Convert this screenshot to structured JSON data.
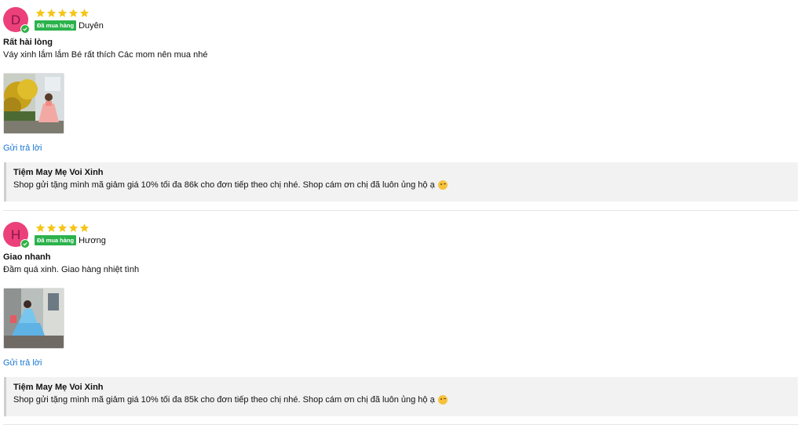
{
  "reviews": [
    {
      "avatar_letter": "D",
      "avatar_color": "#ec407a",
      "rating": 5,
      "badge": "Đã mua hàng",
      "author": "Duyên",
      "title": "Rất hài lòng",
      "text": "Váy xinh lắm lắm Bé rất thích Các mom nên mua nhé",
      "photo": "photo-girl-pink-dress-yellow-flowers",
      "reply_label": "Gửi trả lời",
      "shop_reply": {
        "shop_name": "Tiệm May Mẹ Voi Xinh",
        "text": "Shop gửi tặng mình mã giảm giá 10% tối đa 86k cho đơn tiếp theo chị nhé. Shop cám ơn chị đã luôn ủng hộ ạ",
        "emoji": "face-blowing-kiss-icon"
      }
    },
    {
      "avatar_letter": "H",
      "avatar_color": "#ec407a",
      "rating": 5,
      "badge": "Đã mua hàng",
      "author": "Hương",
      "title": "Giao nhanh",
      "text": "Đầm quá xinh. Giao hàng nhiệt tình",
      "photo": "photo-girl-blue-dress-street",
      "reply_label": "Gửi trả lời",
      "shop_reply": {
        "shop_name": "Tiệm May Mẹ Voi Xinh",
        "text": "Shop gửi tặng mình mã giảm giá 10% tối đa 85k cho đơn tiếp theo chị nhé. Shop cám ơn chị đã luôn ủng hộ ạ",
        "emoji": "face-blowing-kiss-icon"
      }
    }
  ],
  "colors": {
    "star": "#f5c518",
    "badge": "#2bb24c",
    "link": "#1976d2",
    "reply_bg": "#f2f2f2"
  }
}
